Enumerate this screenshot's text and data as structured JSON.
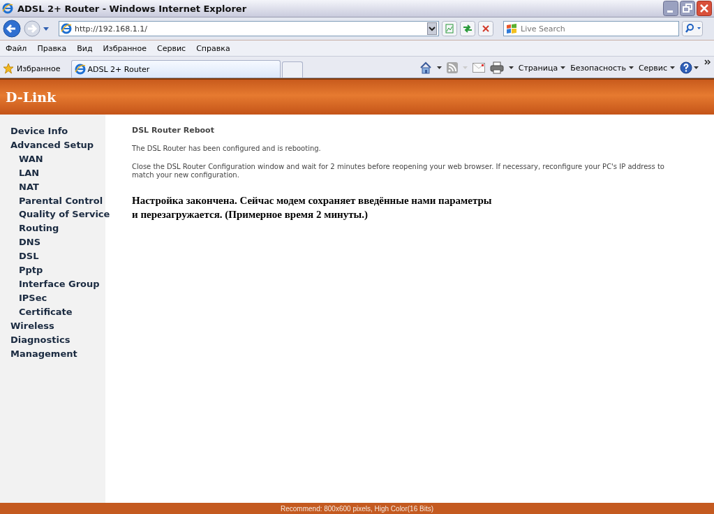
{
  "window": {
    "title": "ADSL 2+ Router - Windows Internet Explorer"
  },
  "address": {
    "url": "http://192.168.1.1/"
  },
  "search": {
    "placeholder": "Live Search"
  },
  "menu": [
    "Файл",
    "Правка",
    "Вид",
    "Избранное",
    "Сервис",
    "Справка"
  ],
  "favorites": {
    "label": "Избранное"
  },
  "tabs": [
    {
      "label": "ADSL 2+ Router",
      "selected": true
    }
  ],
  "command_bar": [
    "Страница",
    "Безопасность",
    "Сервис"
  ],
  "banner": {
    "logo": "D-Link"
  },
  "sidebar": {
    "items": [
      {
        "label": "Device Info"
      },
      {
        "label": "Advanced Setup",
        "children": [
          {
            "label": "WAN"
          },
          {
            "label": "LAN"
          },
          {
            "label": "NAT"
          },
          {
            "label": "Parental Control"
          },
          {
            "label": "Quality of Service"
          },
          {
            "label": "Routing"
          },
          {
            "label": "DNS"
          },
          {
            "label": "DSL"
          },
          {
            "label": "Pptp"
          },
          {
            "label": "Interface Group"
          },
          {
            "label": "IPSec"
          },
          {
            "label": "Certificate"
          }
        ]
      },
      {
        "label": "Wireless"
      },
      {
        "label": "Diagnostics"
      },
      {
        "label": "Management"
      }
    ]
  },
  "content": {
    "title": "DSL Router Reboot",
    "paragraphs": [
      "The DSL Router has been configured and is rebooting.",
      "Close the DSL Router Configuration window and wait for 2 minutes before reopening your web browser. If necessary, reconfigure your PC's IP address to match your new configuration."
    ],
    "note_lines": [
      "Настройка закончена. Сейчас модем сохраняет введённые нами параметры",
      "и перезагружается. (Примерное время 2 минуты.)"
    ]
  },
  "footer": "Recommend: 800x600 pixels, High Color(16 Bits)"
}
